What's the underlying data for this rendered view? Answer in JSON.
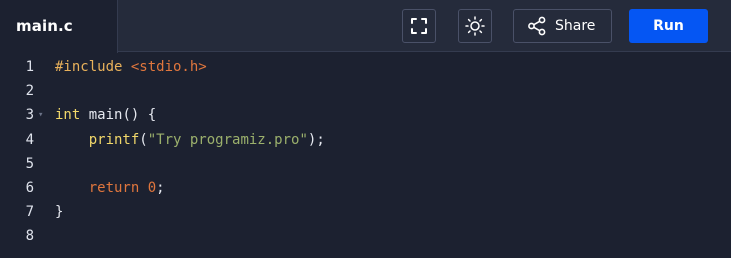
{
  "file_tab": {
    "name": "main.c"
  },
  "toolbar": {
    "fullscreen_icon": "fullscreen-icon",
    "theme_icon": "sun-icon",
    "share_icon": "share-icon",
    "share_label": "Share",
    "run_label": "Run"
  },
  "colors": {
    "editor_bg": "#1c2130",
    "toolbar_bg": "#252b3b",
    "run_button": "#0556f3"
  },
  "code": {
    "lines": [
      {
        "number": "1",
        "tokens": [
          {
            "t": "#include ",
            "c": "pre"
          },
          {
            "t": "<stdio.h>",
            "c": "str"
          }
        ]
      },
      {
        "number": "2",
        "tokens": []
      },
      {
        "number": "3",
        "fold": true,
        "tokens": [
          {
            "t": "int",
            "c": "kw"
          },
          {
            "t": " main() {",
            "c": "plain"
          }
        ]
      },
      {
        "number": "4",
        "tokens": [
          {
            "t": "    ",
            "c": "plain"
          },
          {
            "t": "printf",
            "c": "fn"
          },
          {
            "t": "(",
            "c": "plain"
          },
          {
            "t": "\"Try programiz.pro\"",
            "c": "lit"
          },
          {
            "t": ");",
            "c": "plain"
          }
        ]
      },
      {
        "number": "5",
        "tokens": []
      },
      {
        "number": "6",
        "tokens": [
          {
            "t": "    ",
            "c": "plain"
          },
          {
            "t": "return",
            "c": "ret"
          },
          {
            "t": " ",
            "c": "plain"
          },
          {
            "t": "0",
            "c": "num"
          },
          {
            "t": ";",
            "c": "plain"
          }
        ]
      },
      {
        "number": "7",
        "tokens": [
          {
            "t": "}",
            "c": "plain"
          }
        ]
      },
      {
        "number": "8",
        "tokens": []
      }
    ]
  }
}
